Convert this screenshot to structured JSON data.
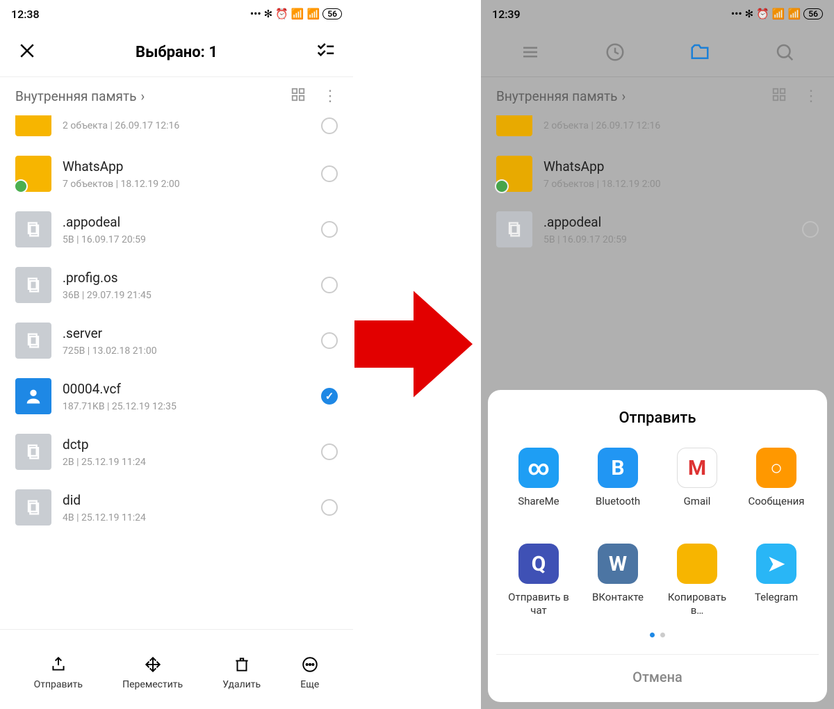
{
  "left": {
    "time": "12:38",
    "battery": "56",
    "header_title": "Выбрано: 1",
    "breadcrumb": "Внутренняя память",
    "files": [
      {
        "name": "",
        "meta": "2 объекта  |  26.09.17 12:16",
        "type": "folder-first"
      },
      {
        "name": "WhatsApp",
        "meta": "7 объектов  |  18.12.19 2:00",
        "type": "folder-wa"
      },
      {
        "name": ".appodeal",
        "meta": "5B  |  16.09.17 20:59",
        "type": "file"
      },
      {
        "name": ".profig.os",
        "meta": "36B  |  29.07.19 21:45",
        "type": "file"
      },
      {
        "name": ".server",
        "meta": "725B  |  13.02.18 21:00",
        "type": "file"
      },
      {
        "name": "00004.vcf",
        "meta": "187.71KB  |  25.12.19 12:35",
        "type": "contact",
        "checked": true
      },
      {
        "name": "dctp",
        "meta": "2B  |  25.12.19 11:24",
        "type": "file"
      },
      {
        "name": "did",
        "meta": "4B  |  25.12.19 11:24",
        "type": "file"
      }
    ],
    "actions": {
      "send": "Отправить",
      "move": "Переместить",
      "delete": "Удалить",
      "more": "Еще"
    }
  },
  "right": {
    "time": "12:39",
    "battery": "56",
    "breadcrumb": "Внутренняя память",
    "files": [
      {
        "name": "",
        "meta": "2 объекта  |  26.09.17 12:16",
        "type": "folder-first"
      },
      {
        "name": "WhatsApp",
        "meta": "7 объектов  |  18.12.19 2:00",
        "type": "folder-wa"
      },
      {
        "name": ".appodeal",
        "meta": "5B  |  16.09.17 20:59",
        "type": "file"
      }
    ],
    "sheet": {
      "title": "Отправить",
      "apps": [
        {
          "label": "ShareMe",
          "color": "#1e9ef4",
          "glyph": "∞"
        },
        {
          "label": "Bluetooth",
          "color": "#2196f3",
          "glyph": "B"
        },
        {
          "label": "Gmail",
          "color": "#fff",
          "glyph": "M"
        },
        {
          "label": "Сообщения",
          "color": "#ff9800",
          "glyph": "○"
        },
        {
          "label": "Отправить в чат",
          "color": "#3f51b5",
          "glyph": "Q"
        },
        {
          "label": "ВКонтакте",
          "color": "#4c75a3",
          "glyph": "W"
        },
        {
          "label": "Копировать в…",
          "color": "#f7b500",
          "glyph": ""
        },
        {
          "label": "Telegram",
          "color": "#29b6f6",
          "glyph": "➤"
        }
      ],
      "cancel": "Отмена"
    }
  }
}
